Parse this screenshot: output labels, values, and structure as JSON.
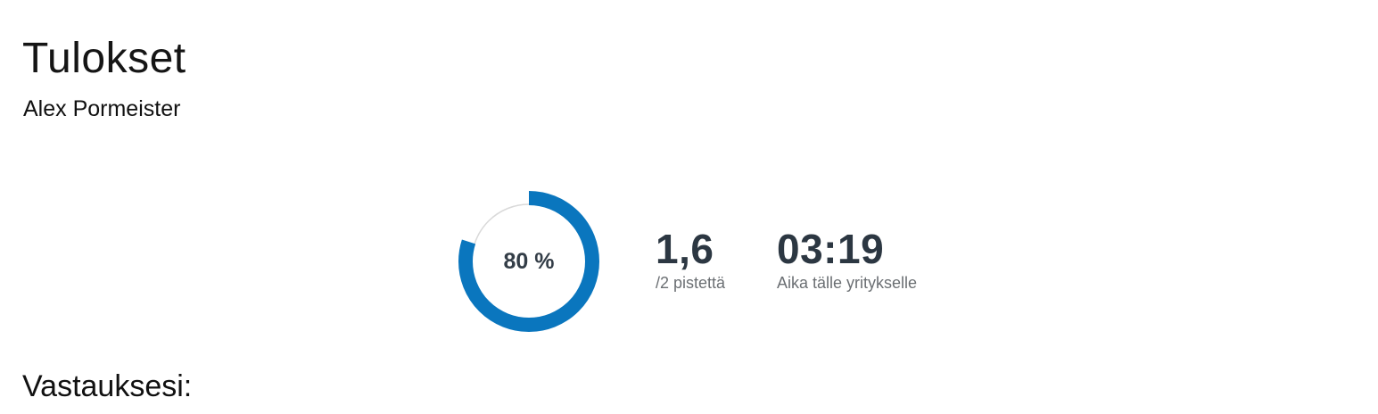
{
  "page": {
    "title": "Tulokset",
    "user_name": "Alex Pormeister"
  },
  "result": {
    "percent_label": "80 %",
    "percent_value": 80,
    "score_value": "1,6",
    "score_caption": "/2 pistettä",
    "time_value": "03:19",
    "time_caption": "Aika tälle yritykselle"
  },
  "answers": {
    "heading": "Vastauksesi:"
  },
  "colors": {
    "progress": "#0a76be",
    "track": "#d9d9d9"
  }
}
